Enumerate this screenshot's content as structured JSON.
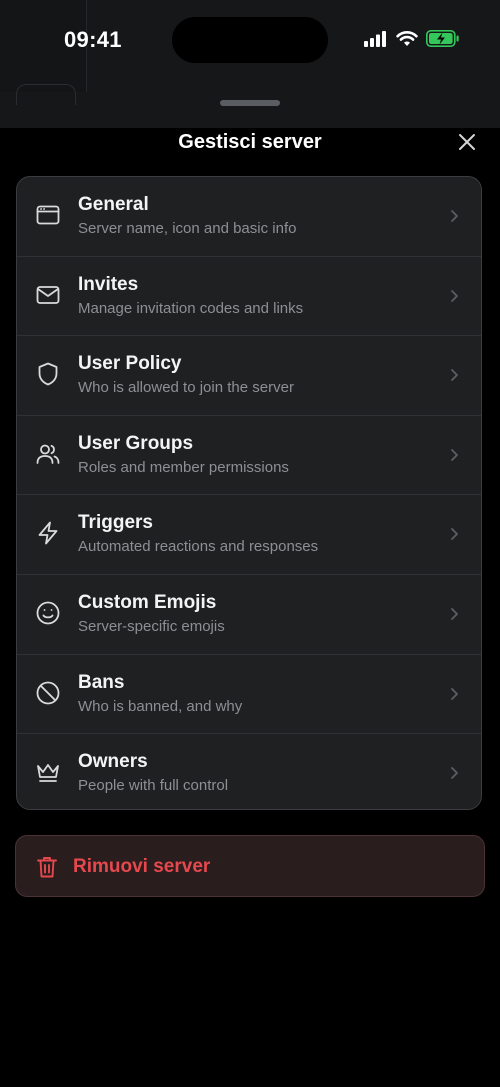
{
  "status_bar": {
    "time": "09:41"
  },
  "sheet": {
    "title": "Gestisci server"
  },
  "menu": [
    {
      "title": "General",
      "subtitle": "Server name, icon and basic info",
      "icon": "browser-window-icon"
    },
    {
      "title": "Invites",
      "subtitle": "Manage invitation codes and links",
      "icon": "envelope-icon"
    },
    {
      "title": "User Policy",
      "subtitle": "Who is allowed to join the server",
      "icon": "shield-icon"
    },
    {
      "title": "User Groups",
      "subtitle": "Roles and member permissions",
      "icon": "users-icon"
    },
    {
      "title": "Triggers",
      "subtitle": "Automated reactions and responses",
      "icon": "lightning-icon"
    },
    {
      "title": "Custom Emojis",
      "subtitle": "Server-specific emojis",
      "icon": "smiley-icon"
    },
    {
      "title": "Bans",
      "subtitle": "Who is banned, and why",
      "icon": "ban-icon"
    },
    {
      "title": "Owners",
      "subtitle": "People with full control",
      "icon": "crown-icon"
    }
  ],
  "danger": {
    "remove_label": "Rimuovi server",
    "icon": "trash-icon"
  },
  "colors": {
    "danger": "#e5484d",
    "battery": "#34c759"
  }
}
